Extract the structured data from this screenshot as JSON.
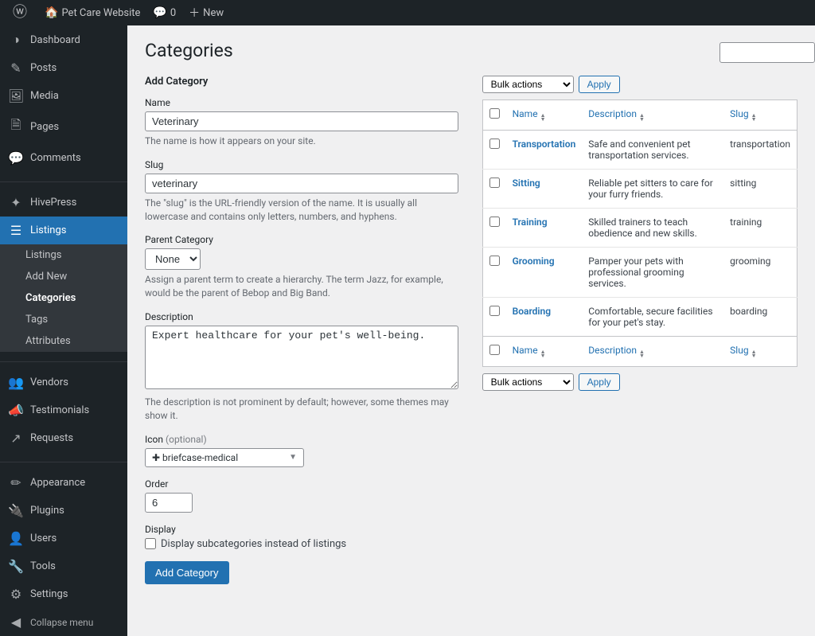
{
  "toolbar": {
    "site_name": "Pet Care Website",
    "comments_count": "0",
    "new_label": "New"
  },
  "sidebar": {
    "items": [
      {
        "icon": "◑",
        "label": "Dashboard"
      },
      {
        "icon": "✎",
        "label": "Posts"
      },
      {
        "icon": "🖼",
        "label": "Media"
      },
      {
        "icon": "🗎",
        "label": "Pages"
      },
      {
        "icon": "💬",
        "label": "Comments"
      },
      {
        "icon": "✦",
        "label": "HivePress",
        "sep": true
      },
      {
        "icon": "☰",
        "label": "Listings",
        "current": true
      },
      {
        "icon": "👥",
        "label": "Vendors",
        "sep": true
      },
      {
        "icon": "📣",
        "label": "Testimonials"
      },
      {
        "icon": "↗",
        "label": "Requests"
      },
      {
        "icon": "✏",
        "label": "Appearance",
        "sep": true
      },
      {
        "icon": "🔌",
        "label": "Plugins"
      },
      {
        "icon": "👤",
        "label": "Users"
      },
      {
        "icon": "🔧",
        "label": "Tools"
      },
      {
        "icon": "⚙",
        "label": "Settings"
      }
    ],
    "collapse_label": "Collapse menu",
    "submenu": {
      "items": [
        "Listings",
        "Add New",
        "Categories",
        "Tags",
        "Attributes"
      ],
      "current_index": 2
    }
  },
  "page": {
    "title": "Categories",
    "add_category_heading": "Add Category"
  },
  "form": {
    "name_label": "Name",
    "name_value": "Veterinary",
    "name_help": "The name is how it appears on your site.",
    "slug_label": "Slug",
    "slug_value": "veterinary",
    "slug_help": "The \"slug\" is the URL-friendly version of the name. It is usually all lowercase and contains only letters, numbers, and hyphens.",
    "parent_label": "Parent Category",
    "parent_value": "None",
    "parent_help": "Assign a parent term to create a hierarchy. The term Jazz, for example, would be the parent of Bebop and Big Band.",
    "description_label": "Description",
    "description_value": "Expert healthcare for your pet's well-being.",
    "description_help": "The description is not prominent by default; however, some themes may show it.",
    "icon_label": "Icon",
    "icon_optional": " (optional)",
    "icon_value": "briefcase-medical",
    "order_label": "Order",
    "order_value": "6",
    "display_label": "Display",
    "display_checkbox_label": "Display subcategories instead of listings",
    "submit_label": "Add Category"
  },
  "table": {
    "bulk_actions_label": "Bulk actions",
    "apply_label": "Apply",
    "headers": {
      "name": "Name",
      "description": "Description",
      "slug": "Slug"
    },
    "rows": [
      {
        "name": "Transportation",
        "description": "Safe and convenient pet transportation services.",
        "slug": "transportation"
      },
      {
        "name": "Sitting",
        "description": "Reliable pet sitters to care for your furry friends.",
        "slug": "sitting"
      },
      {
        "name": "Training",
        "description": "Skilled trainers to teach obedience and new skills.",
        "slug": "training"
      },
      {
        "name": "Grooming",
        "description": "Pamper your pets with professional grooming services.",
        "slug": "grooming"
      },
      {
        "name": "Boarding",
        "description": "Comfortable, secure facilities for your pet's stay.",
        "slug": "boarding"
      }
    ]
  }
}
